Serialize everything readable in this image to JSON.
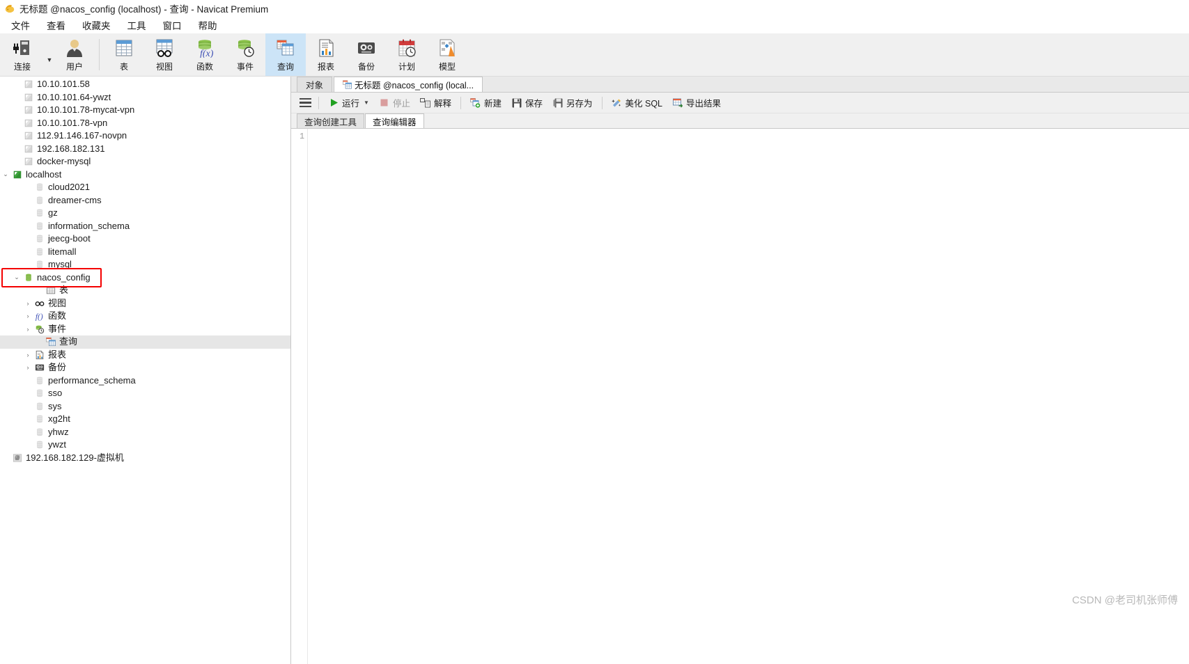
{
  "window": {
    "icon": "navicat-app-icon",
    "title": "无标题 @nacos_config (localhost) - 查询 - Navicat Premium"
  },
  "menubar": {
    "items": [
      {
        "label": "文件",
        "name": "menu-file"
      },
      {
        "label": "查看",
        "name": "menu-view"
      },
      {
        "label": "收藏夹",
        "name": "menu-favorites"
      },
      {
        "label": "工具",
        "name": "menu-tools"
      },
      {
        "label": "窗口",
        "name": "menu-window"
      },
      {
        "label": "帮助",
        "name": "menu-help"
      }
    ]
  },
  "toolbar": {
    "buttons": [
      {
        "label": "连接",
        "icon": "connection-icon",
        "active": false,
        "has_caret": true
      },
      {
        "label": "用户",
        "icon": "user-icon",
        "active": false,
        "has_caret": false
      },
      {
        "label": "表",
        "icon": "table-icon",
        "active": false,
        "has_caret": false
      },
      {
        "label": "视图",
        "icon": "view-icon",
        "active": false,
        "has_caret": false
      },
      {
        "label": "函数",
        "icon": "function-icon",
        "active": false,
        "has_caret": false
      },
      {
        "label": "事件",
        "icon": "event-icon",
        "active": false,
        "has_caret": false
      },
      {
        "label": "查询",
        "icon": "query-icon",
        "active": true,
        "has_caret": false
      },
      {
        "label": "报表",
        "icon": "report-icon",
        "active": false,
        "has_caret": false
      },
      {
        "label": "备份",
        "icon": "backup-icon",
        "active": false,
        "has_caret": false
      },
      {
        "label": "计划",
        "icon": "schedule-icon",
        "active": false,
        "has_caret": false
      },
      {
        "label": "模型",
        "icon": "model-icon",
        "active": false,
        "has_caret": false
      }
    ],
    "accent_selected": "#cce4f7"
  },
  "sidebar": {
    "tree": [
      {
        "label": "10.10.101.58",
        "icon": "connection-offline-icon",
        "depth": 1,
        "twisty": "",
        "selected": false
      },
      {
        "label": "10.10.101.64-ywzt",
        "icon": "connection-offline-icon",
        "depth": 1,
        "twisty": "",
        "selected": false
      },
      {
        "label": "10.10.101.78-mycat-vpn",
        "icon": "connection-offline-icon",
        "depth": 1,
        "twisty": "",
        "selected": false
      },
      {
        "label": "10.10.101.78-vpn",
        "icon": "connection-offline-icon",
        "depth": 1,
        "twisty": "",
        "selected": false
      },
      {
        "label": "112.91.146.167-novpn",
        "icon": "connection-offline-icon",
        "depth": 1,
        "twisty": "",
        "selected": false
      },
      {
        "label": "192.168.182.131",
        "icon": "connection-offline-icon",
        "depth": 1,
        "twisty": "",
        "selected": false
      },
      {
        "label": "docker-mysql",
        "icon": "connection-offline-icon",
        "depth": 1,
        "twisty": "",
        "selected": false
      },
      {
        "label": "localhost",
        "icon": "connection-online-icon",
        "depth": 0,
        "twisty": "expanded",
        "selected": false
      },
      {
        "label": "cloud2021",
        "icon": "database-icon",
        "depth": 2,
        "twisty": "",
        "selected": false
      },
      {
        "label": "dreamer-cms",
        "icon": "database-icon",
        "depth": 2,
        "twisty": "",
        "selected": false
      },
      {
        "label": "gz",
        "icon": "database-icon",
        "depth": 2,
        "twisty": "",
        "selected": false
      },
      {
        "label": "information_schema",
        "icon": "database-icon",
        "depth": 2,
        "twisty": "",
        "selected": false
      },
      {
        "label": "jeecg-boot",
        "icon": "database-icon",
        "depth": 2,
        "twisty": "",
        "selected": false
      },
      {
        "label": "litemall",
        "icon": "database-icon",
        "depth": 2,
        "twisty": "",
        "selected": false
      },
      {
        "label": "mysql",
        "icon": "database-icon",
        "depth": 2,
        "twisty": "",
        "selected": false
      },
      {
        "label": "nacos_config",
        "icon": "database-open-icon",
        "depth": 1,
        "twisty": "expanded",
        "selected": false
      },
      {
        "label": "表",
        "icon": "tables-folder-icon",
        "depth": 3,
        "twisty": "",
        "selected": false
      },
      {
        "label": "视图",
        "icon": "views-folder-icon",
        "depth": 2,
        "twisty": "collapsed",
        "selected": false
      },
      {
        "label": "函数",
        "icon": "functions-folder-icon",
        "depth": 2,
        "twisty": "collapsed",
        "selected": false
      },
      {
        "label": "事件",
        "icon": "events-folder-icon",
        "depth": 2,
        "twisty": "collapsed",
        "selected": false
      },
      {
        "label": "查询",
        "icon": "queries-folder-icon",
        "depth": 3,
        "twisty": "",
        "selected": true
      },
      {
        "label": "报表",
        "icon": "reports-folder-icon",
        "depth": 2,
        "twisty": "collapsed",
        "selected": false
      },
      {
        "label": "备份",
        "icon": "backups-folder-icon",
        "depth": 2,
        "twisty": "collapsed",
        "selected": false
      },
      {
        "label": "performance_schema",
        "icon": "database-icon",
        "depth": 2,
        "twisty": "",
        "selected": false
      },
      {
        "label": "sso",
        "icon": "database-icon",
        "depth": 2,
        "twisty": "",
        "selected": false
      },
      {
        "label": "sys",
        "icon": "database-icon",
        "depth": 2,
        "twisty": "",
        "selected": false
      },
      {
        "label": "xg2ht",
        "icon": "database-icon",
        "depth": 2,
        "twisty": "",
        "selected": false
      },
      {
        "label": "yhwz",
        "icon": "database-icon",
        "depth": 2,
        "twisty": "",
        "selected": false
      },
      {
        "label": "ywzt",
        "icon": "database-icon",
        "depth": 2,
        "twisty": "",
        "selected": false
      },
      {
        "label": "192.168.182.129-虚拟机",
        "icon": "postgresql-connection-icon",
        "depth": 0,
        "twisty": "",
        "selected": false
      }
    ],
    "annotation": {
      "color": "#f40000",
      "target": "nacos_config"
    }
  },
  "main": {
    "tabs": [
      {
        "label": "对象",
        "icon": "",
        "active": false,
        "name": "tab-objects"
      },
      {
        "label": "无标题 @nacos_config (local...",
        "icon": "query-tab-icon",
        "active": true,
        "name": "tab-query"
      }
    ],
    "query_toolbar": {
      "menu_icon": "hamburger-menu-icon",
      "buttons": [
        {
          "label": "运行",
          "icon": "play-icon",
          "disabled": false,
          "caret": true,
          "name": "run-button"
        },
        {
          "label": "停止",
          "icon": "stop-icon",
          "disabled": true,
          "caret": false,
          "name": "stop-button"
        },
        {
          "label": "解释",
          "icon": "explain-icon",
          "disabled": false,
          "caret": false,
          "name": "explain-button"
        },
        {
          "label": "新建",
          "icon": "new-query-icon",
          "disabled": false,
          "caret": false,
          "name": "new-button"
        },
        {
          "label": "保存",
          "icon": "save-icon",
          "disabled": false,
          "caret": false,
          "name": "save-button"
        },
        {
          "label": "另存为",
          "icon": "save-as-icon",
          "disabled": false,
          "caret": false,
          "name": "save-as-button"
        },
        {
          "label": "美化 SQL",
          "icon": "beautify-sql-icon",
          "disabled": false,
          "caret": false,
          "name": "beautify-sql-button"
        },
        {
          "label": "导出结果",
          "icon": "export-result-icon",
          "disabled": false,
          "caret": false,
          "name": "export-result-button"
        }
      ]
    },
    "sub_tabs": [
      {
        "label": "查询创建工具",
        "active": false,
        "name": "subtab-query-builder"
      },
      {
        "label": "查询编辑器",
        "active": true,
        "name": "subtab-query-editor"
      }
    ],
    "editor": {
      "line_numbers": [
        "1"
      ],
      "content": ""
    }
  },
  "watermark": {
    "text": "CSDN @老司机张师傅"
  }
}
